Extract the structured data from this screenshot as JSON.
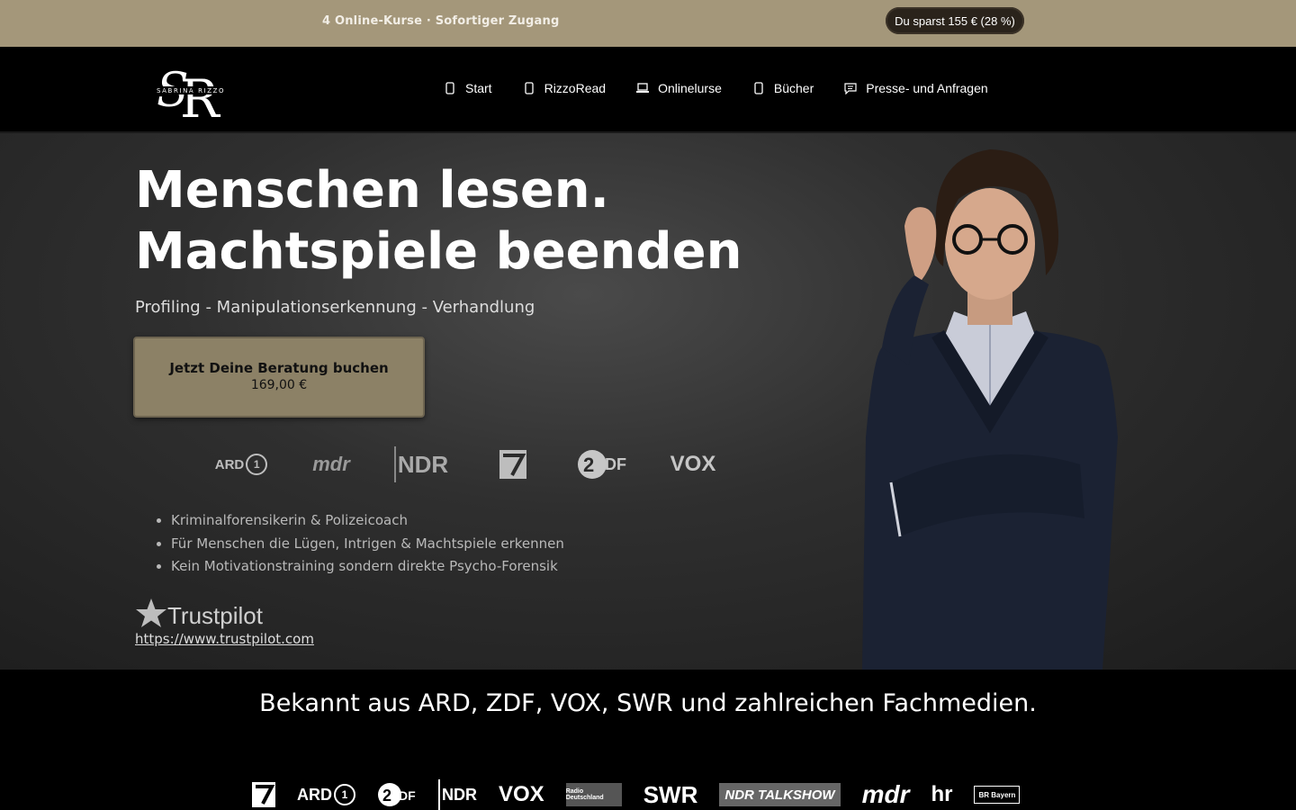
{
  "topbar": {
    "promo": "4 Online-Kurse · Sofortiger Zugang",
    "savings": "Du sparst 155 €  (28 %)"
  },
  "logo": {
    "alt": "Sabrina Rizzo",
    "monogram": "SR",
    "wordmark": "SABRINA RIZZO"
  },
  "nav": [
    {
      "label": "Start",
      "icon": "phone-icon"
    },
    {
      "label": "RizzoRead",
      "icon": "phone-icon"
    },
    {
      "label": "Onlinelurse",
      "icon": "laptop-icon"
    },
    {
      "label": "Bücher",
      "icon": "phone-icon"
    },
    {
      "label": "Presse- und Anfragen",
      "icon": "chat-icon"
    }
  ],
  "hero": {
    "title_line1": "Menschen lesen.",
    "title_line2": "Machtspiele beenden",
    "subtitle": "Profiling - Manipulationserkennung - Verhandlung",
    "cta_label": "Jetzt Deine Beratung buchen",
    "cta_price": "169,00 €",
    "logos": [
      "ARD",
      "mdr",
      "NDR",
      "ProSieben",
      "ZDF",
      "VOX"
    ],
    "bullets": [
      "Kriminalforensikerin & Polizeicoach",
      "Für Menschen die Lügen, Intrigen & Machtspiele erkennen",
      "Kein Motivationstraining sondern direkte Psycho-Forensik"
    ],
    "trustpilot": "Trustpilot",
    "trustpilot_link": "https://www.trustpilot.com"
  },
  "known_from": "Bekannt aus ARD, ZDF, VOX, SWR und zahlreichen Fachmedien.",
  "media_logos": [
    "ProSieben",
    "ARD",
    "ZDF",
    "NDR",
    "VOX",
    "Radio Deutschland",
    "SWR",
    "NDR TALKSHOW",
    "mdr",
    "hr",
    "BR Bayern"
  ],
  "colors": {
    "topbar": "#a4977a",
    "cta": "#8c8166",
    "background": "#000000"
  }
}
